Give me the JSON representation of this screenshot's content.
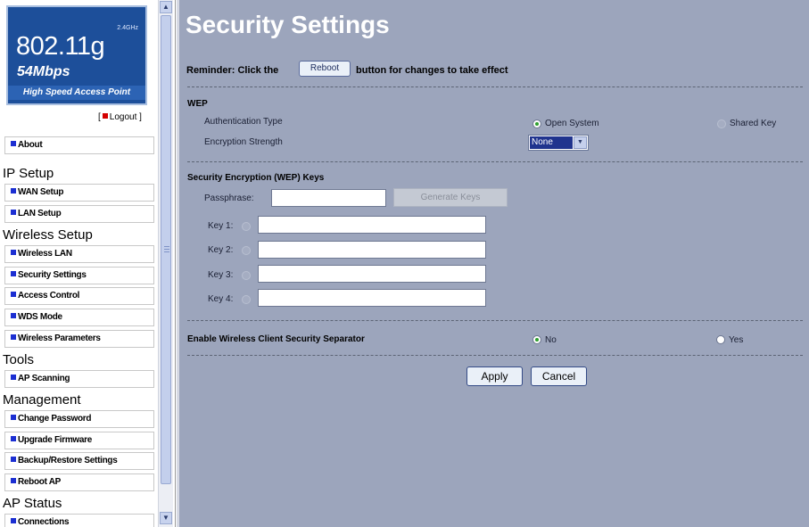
{
  "logo": {
    "frequency": "2.4GHz",
    "standard": "802.11g",
    "speed": "54Mbps",
    "tagline": "High Speed Access Point"
  },
  "logout": {
    "open_bracket": "[",
    "label": "Logout",
    "close_bracket": "]"
  },
  "nav": {
    "about": "About",
    "ip_setup": {
      "heading": "IP Setup",
      "items": [
        "WAN Setup",
        "LAN Setup"
      ]
    },
    "wireless_setup": {
      "heading": "Wireless Setup",
      "items": [
        "Wireless LAN",
        "Security Settings",
        "Access Control",
        "WDS Mode",
        "Wireless Parameters"
      ]
    },
    "tools": {
      "heading": "Tools",
      "items": [
        "AP Scanning"
      ]
    },
    "management": {
      "heading": "Management",
      "items": [
        "Change Password",
        "Upgrade Firmware",
        "Backup/Restore Settings",
        "Reboot AP"
      ]
    },
    "ap_status": {
      "heading": "AP Status",
      "items": [
        "Connections"
      ]
    }
  },
  "main": {
    "title": "Security Settings",
    "reminder_before": "Reminder: Click the",
    "reboot_button": "Reboot",
    "reminder_after": "button for changes to take effect",
    "wep": {
      "heading": "WEP",
      "auth_label": "Authentication Type",
      "auth_options": [
        "Open System",
        "Shared Key"
      ],
      "auth_selected": "Open System",
      "strength_label": "Encryption Strength",
      "strength_value": "None"
    },
    "keys": {
      "heading": "Security Encryption (WEP) Keys",
      "passphrase_label": "Passphrase:",
      "passphrase_value": "",
      "generate_button": "Generate Keys",
      "key_labels": [
        "Key 1:",
        "Key 2:",
        "Key 3:",
        "Key 4:"
      ]
    },
    "separator": {
      "label": "Enable Wireless Client Security Separator",
      "options": [
        "No",
        "Yes"
      ],
      "selected": "No"
    },
    "apply_button": "Apply",
    "cancel_button": "Cancel"
  },
  "colors": {
    "panel_bg": "#9ca5bc",
    "logo_bg": "#1d4f9a",
    "nav_bullet": "#1c2fd2",
    "logout_bullet": "#d40000",
    "radio_selected": "#2f9f2f"
  }
}
